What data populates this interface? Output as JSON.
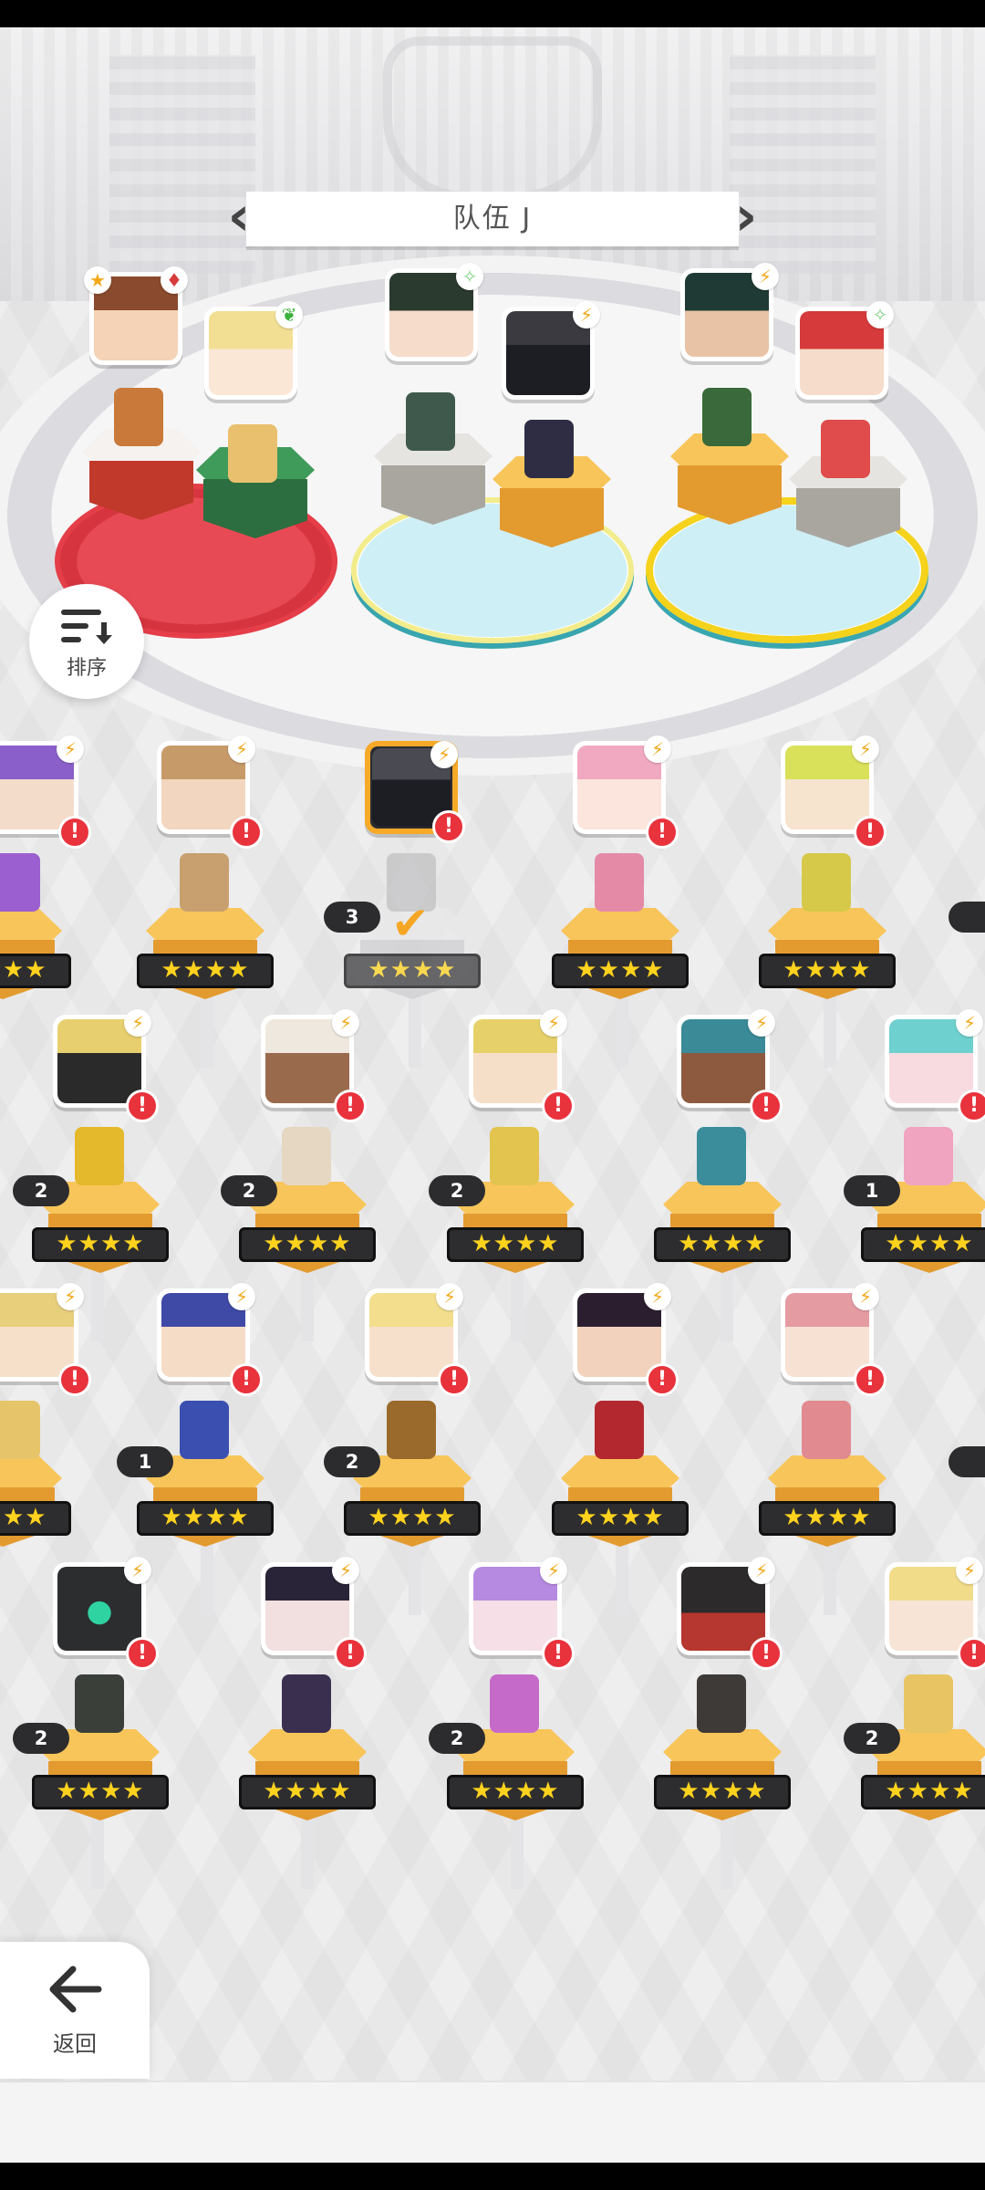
{
  "team": {
    "title": "队伍 J",
    "prev_icon": "chevron-left-icon",
    "next_icon": "chevron-right-icon"
  },
  "sort": {
    "label": "排序",
    "icon": "sort-descending-icon"
  },
  "back": {
    "label": "返回",
    "icon": "arrow-left-icon"
  },
  "colors": {
    "accent": "#f7a928",
    "alert": "#e8323c",
    "star": "#ffd21e",
    "slot_red": "#e53e49",
    "slot_yellow": "#f5d21b",
    "slot_cyan": "#39a5ae"
  },
  "formation": [
    {
      "slot": "red",
      "corner_badges": [
        "star-icon",
        "diamond-suit-icon"
      ]
    },
    {
      "slot": "red",
      "corner_badges": [
        "leaf-icon"
      ]
    },
    {
      "slot": "cyan",
      "corner_badges": [
        "sparkle-icon"
      ]
    },
    {
      "slot": "cyan",
      "corner_badges": [
        "lightning-icon"
      ]
    },
    {
      "slot": "yellow",
      "corner_badges": [
        "lightning-icon"
      ]
    },
    {
      "slot": "yellow",
      "corner_badges": [
        "sparkle-icon"
      ]
    }
  ],
  "roster": {
    "stars": "★★★★",
    "row1": {
      "count": "3"
    },
    "row2": {
      "counts": [
        "2",
        "2",
        "2",
        "1"
      ]
    },
    "row3": {
      "counts": [
        "1",
        "2"
      ]
    },
    "row4": {
      "counts": [
        "2",
        "2",
        "2"
      ]
    }
  },
  "alert_glyph": "!",
  "check_glyph": "✔"
}
